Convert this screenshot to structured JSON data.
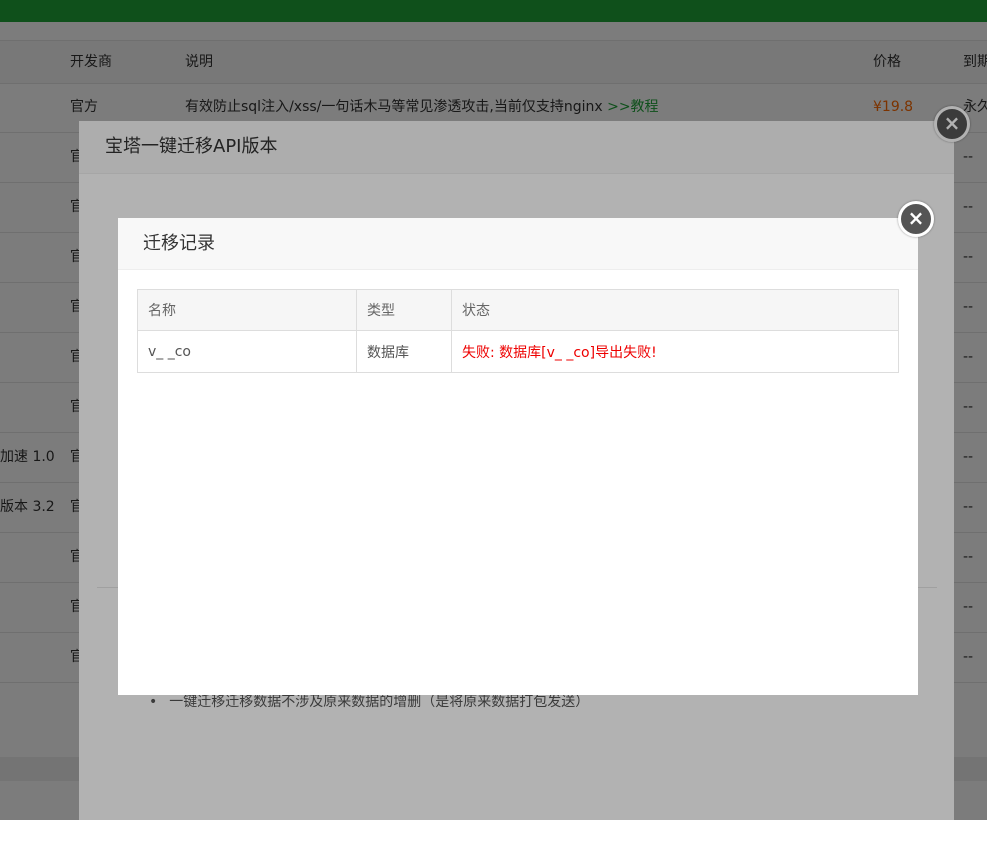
{
  "background": {
    "columns": {
      "developer": "开发商",
      "description": "说明",
      "price": "价格",
      "expire": "到期"
    },
    "first_row": {
      "developer": "官方",
      "description": "有效防止sql注入/xss/一句话木马等常见渗透攻击,当前仅支持nginx",
      "link": ">>教程",
      "price": "¥19.8",
      "expire": "永久"
    },
    "rows": [
      {
        "name": "",
        "developer": "官方",
        "expire": "--"
      },
      {
        "name": "",
        "developer": "官方",
        "expire": "--"
      },
      {
        "name": "",
        "developer": "官方",
        "expire": "--"
      },
      {
        "name": "",
        "developer": "官方",
        "expire": "--"
      },
      {
        "name": "",
        "developer": "官方",
        "expire": "--"
      },
      {
        "name": "",
        "developer": "官方",
        "expire": "--"
      },
      {
        "name": "加速 1.0",
        "developer": "官方",
        "expire": "--"
      },
      {
        "name": "版本 3.2",
        "developer": "官方",
        "expire": "--"
      },
      {
        "name": "",
        "developer": "官方",
        "expire": "--"
      },
      {
        "name": "",
        "developer": "官方",
        "expire": "--"
      },
      {
        "name": "",
        "developer": "官方",
        "expire": "--"
      }
    ]
  },
  "outer_dialog": {
    "title": "宝塔一键迁移API版本",
    "note": "一键迁移迁移数据不涉及原来数据的增删（是将原来数据打包发送）",
    "close_icon": "×"
  },
  "inner_dialog": {
    "title": "迁移记录",
    "close_icon": "×",
    "headers": {
      "name": "名称",
      "type": "类型",
      "status": "状态"
    },
    "records": [
      {
        "name": "v_        _co",
        "type": "数据库",
        "status": "失败: 数据库[v_            _co]导出失败!"
      }
    ]
  },
  "colors": {
    "accent": "#20a53a",
    "error": "#e00000",
    "price": "#ff6a00"
  }
}
